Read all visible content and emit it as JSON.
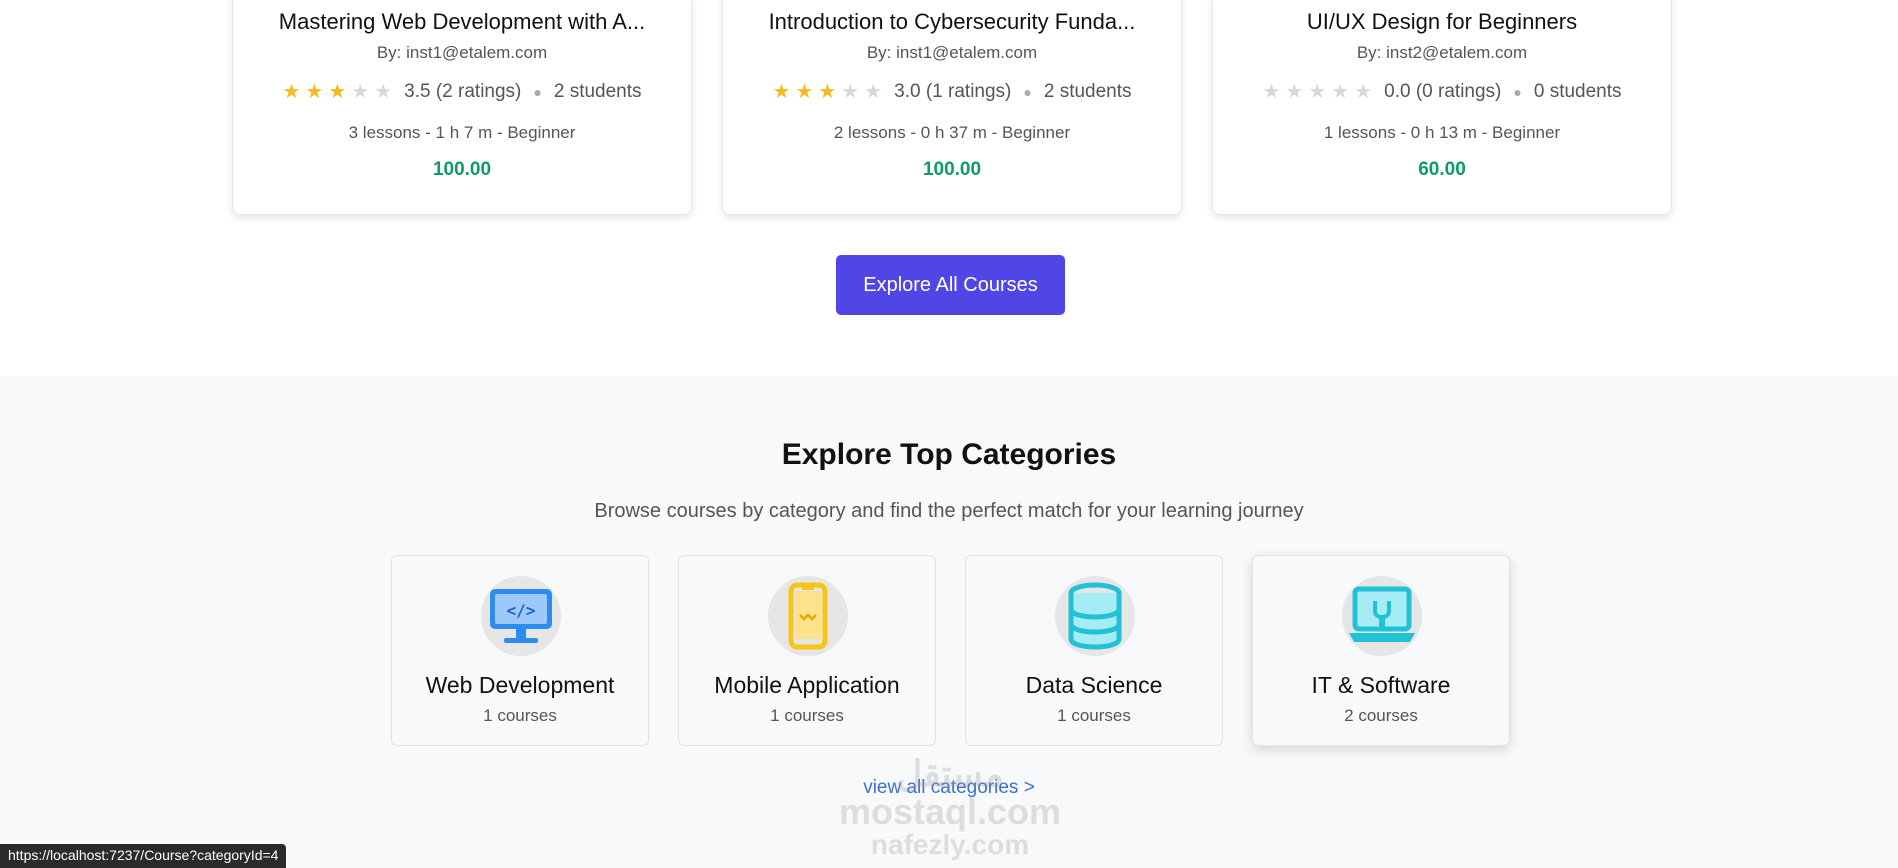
{
  "courses": [
    {
      "title": "Mastering Web Development with A...",
      "instructor": "By: inst1@etalem.com",
      "rating_stars": 3,
      "rating_text": "3.5 (2 ratings)",
      "students": "2 students",
      "info": "3 lessons - 1 h 7 m - Beginner",
      "price": "100.00"
    },
    {
      "title": "Introduction to Cybersecurity Funda...",
      "instructor": "By: inst1@etalem.com",
      "rating_stars": 3,
      "rating_text": "3.0 (1 ratings)",
      "students": "2 students",
      "info": "2 lessons - 0 h 37 m - Beginner",
      "price": "100.00"
    },
    {
      "title": "UI/UX Design for Beginners",
      "instructor": "By: inst2@etalem.com",
      "rating_stars": 0,
      "rating_text": "0.0 (0 ratings)",
      "students": "0 students",
      "info": "1 lessons - 0 h 13 m - Beginner",
      "price": "60.00"
    }
  ],
  "explore_button": "Explore All Courses",
  "categories_section": {
    "heading": "Explore Top Categories",
    "subheading": "Browse courses by category and find the perfect match for your learning journey",
    "items": [
      {
        "name": "Web Development",
        "count": "1 courses",
        "icon": "monitor-code-icon",
        "color": "#2d8cf0"
      },
      {
        "name": "Mobile Application",
        "count": "1 courses",
        "icon": "smartphone-icon",
        "color": "#f5c518"
      },
      {
        "name": "Data Science",
        "count": "1 courses",
        "icon": "database-icon",
        "color": "#22c1d6"
      },
      {
        "name": "IT & Software",
        "count": "2 courses",
        "icon": "laptop-tools-icon",
        "color": "#22c1d6"
      }
    ],
    "view_all": "view all categories >"
  },
  "watermark": {
    "line1": "مستقل",
    "line2": "mostaql.com",
    "line3": "nafezly.com"
  },
  "status_url": "https://localhost:7237/Course?categoryId=4",
  "colors": {
    "accent": "#4f46e5",
    "price": "#0e9a6a",
    "star": "#f5b921",
    "link": "#3b6fd4"
  }
}
